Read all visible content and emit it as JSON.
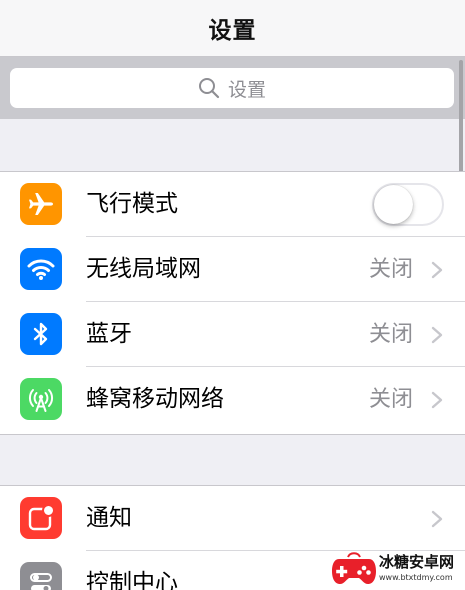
{
  "navbar": {
    "title": "设置"
  },
  "search": {
    "placeholder": "设置"
  },
  "groups": [
    {
      "rows": [
        {
          "label": "飞行模式",
          "icon": "airplane-icon",
          "icon_color": "#ff9500",
          "control": "toggle",
          "toggle_on": false
        },
        {
          "label": "无线局域网",
          "icon": "wifi-icon",
          "icon_color": "#007aff",
          "value": "关闭"
        },
        {
          "label": "蓝牙",
          "icon": "bluetooth-icon",
          "icon_color": "#007aff",
          "value": "关闭"
        },
        {
          "label": "蜂窝移动网络",
          "icon": "cellular-icon",
          "icon_color": "#4cd964",
          "value": "关闭"
        }
      ]
    },
    {
      "rows": [
        {
          "label": "通知",
          "icon": "notifications-icon",
          "icon_color": "#ff3b30"
        },
        {
          "label": "控制中心",
          "icon": "control-center-icon",
          "icon_color": "#8e8e93"
        }
      ]
    }
  ],
  "watermark": {
    "title": "冰糖安卓网",
    "url": "www.btxtdmy.com",
    "logo_color": "#e8202a"
  }
}
